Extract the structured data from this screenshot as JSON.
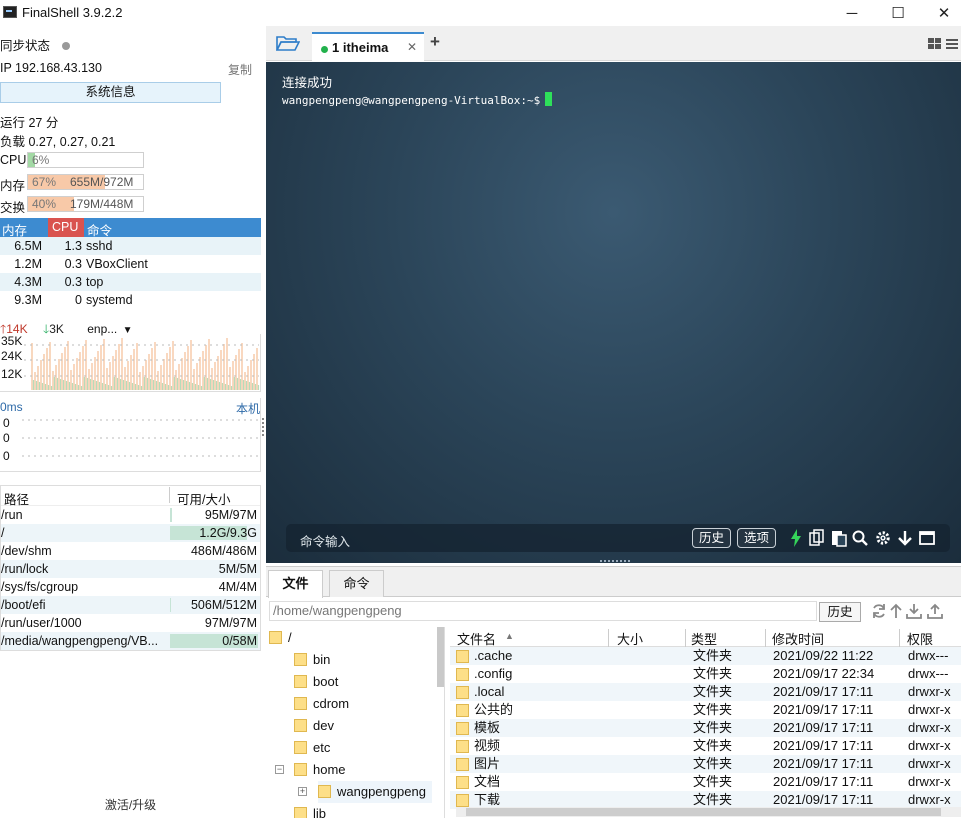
{
  "window": {
    "title": "FinalShell 3.9.2.2",
    "minimize": "─",
    "maximize": "☐",
    "close": "✕"
  },
  "left": {
    "sync_status": "同步状态",
    "ip": "IP 192.168.43.130",
    "copy": "复制",
    "sysinfo_button": "系统信息",
    "uptime": "运行 27 分",
    "load": "负载 0.27, 0.27, 0.21",
    "cpu": {
      "label": "CPU",
      "text": "6%",
      "percent": 6
    },
    "mem": {
      "label": "内存",
      "text": "67%",
      "detail": "655M/972M",
      "percent": 67
    },
    "swap": {
      "label": "交换",
      "text": "40%",
      "detail": "179M/448M",
      "percent": 40
    },
    "proc_headers": {
      "mem": "内存",
      "cpu": "CPU",
      "cmd": "命令"
    },
    "processes": [
      {
        "mem": "6.5M",
        "cpu": "1.3",
        "cmd": "sshd"
      },
      {
        "mem": "1.2M",
        "cpu": "0.3",
        "cmd": "VBoxClient"
      },
      {
        "mem": "4.3M",
        "cpu": "0.3",
        "cmd": "top"
      },
      {
        "mem": "9.3M",
        "cpu": "0",
        "cmd": "systemd"
      }
    ],
    "net": {
      "up": "14K",
      "down": "3K",
      "iface": "enp...",
      "y_labels": [
        "35K",
        "24K",
        "12K"
      ]
    },
    "ping": {
      "label": "0ms",
      "host": "本机",
      "values": [
        "0",
        "0",
        "0"
      ]
    },
    "disk_headers": {
      "path": "路径",
      "size": "可用/大小"
    },
    "disks": [
      {
        "path": "/run",
        "size": "95M/97M",
        "used_fraction": 0.02
      },
      {
        "path": "/",
        "size": "1.2G/9.3G",
        "used_fraction": 0.87
      },
      {
        "path": "/dev/shm",
        "size": "486M/486M",
        "used_fraction": 0
      },
      {
        "path": "/run/lock",
        "size": "5M/5M",
        "used_fraction": 0
      },
      {
        "path": "/sys/fs/cgroup",
        "size": "4M/4M",
        "used_fraction": 0
      },
      {
        "path": "/boot/efi",
        "size": "506M/512M",
        "used_fraction": 0.01
      },
      {
        "path": "/run/user/1000",
        "size": "97M/97M",
        "used_fraction": 0
      },
      {
        "path": "/media/wangpengpeng/VB...",
        "size": "0/58M",
        "used_fraction": 1
      }
    ],
    "upgrade": "激活/升级"
  },
  "tabs": {
    "session_label": "1 itheima",
    "close": "✕",
    "add": "+"
  },
  "terminal": {
    "line1": "连接成功",
    "prompt": "wangpengpeng@wangpengpeng-VirtualBox:~$",
    "cmd_placeholder": "命令输入",
    "history": "历史",
    "options": "选项"
  },
  "files": {
    "tab_files": "文件",
    "tab_commands": "命令",
    "path": "/home/wangpengpeng",
    "history": "历史",
    "tree": [
      {
        "name": "/",
        "level": 0
      },
      {
        "name": "bin",
        "level": 1
      },
      {
        "name": "boot",
        "level": 1
      },
      {
        "name": "cdrom",
        "level": 1
      },
      {
        "name": "dev",
        "level": 1
      },
      {
        "name": "etc",
        "level": 1
      },
      {
        "name": "home",
        "level": 1
      },
      {
        "name": "wangpengpeng",
        "level": 2
      },
      {
        "name": "lib",
        "level": 1
      }
    ],
    "headers": {
      "name": "文件名",
      "size": "大小",
      "type": "类型",
      "mtime": "修改时间",
      "perm": "权限"
    },
    "rows": [
      {
        "name": ".cache",
        "type": "文件夹",
        "mtime": "2021/09/22 11:22",
        "perm": "drwx---"
      },
      {
        "name": ".config",
        "type": "文件夹",
        "mtime": "2021/09/17 22:34",
        "perm": "drwx---"
      },
      {
        "name": ".local",
        "type": "文件夹",
        "mtime": "2021/09/17 17:11",
        "perm": "drwxr-x"
      },
      {
        "name": "公共的",
        "type": "文件夹",
        "mtime": "2021/09/17 17:11",
        "perm": "drwxr-x"
      },
      {
        "name": "模板",
        "type": "文件夹",
        "mtime": "2021/09/17 17:11",
        "perm": "drwxr-x"
      },
      {
        "name": "视频",
        "type": "文件夹",
        "mtime": "2021/09/17 17:11",
        "perm": "drwxr-x"
      },
      {
        "name": "图片",
        "type": "文件夹",
        "mtime": "2021/09/17 17:11",
        "perm": "drwxr-x"
      },
      {
        "name": "文档",
        "type": "文件夹",
        "mtime": "2021/09/17 17:11",
        "perm": "drwxr-x"
      },
      {
        "name": "下载",
        "type": "文件夹",
        "mtime": "2021/09/17 17:11",
        "perm": "drwxr-x"
      }
    ]
  },
  "colors": {
    "accent": "#3d8bd0",
    "cpu_header": "#d9534f",
    "cpu_fill": "#a3d9a5",
    "mem_fill": "#f8c9a8",
    "cursor": "#2ee05a"
  }
}
